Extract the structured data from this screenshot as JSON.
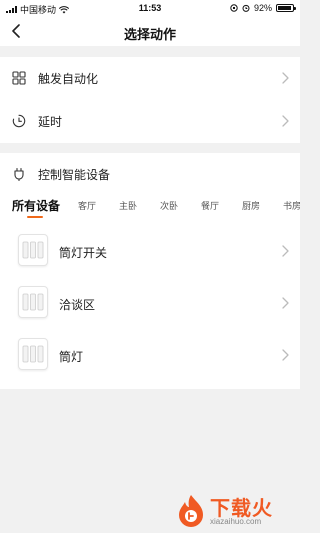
{
  "status_bar": {
    "carrier": "中国移动",
    "time": "11:53",
    "battery_percent": "92%",
    "battery_level": 0.92
  },
  "nav": {
    "title": "选择动作"
  },
  "trigger_section": {
    "items": [
      {
        "label": "触发自动化",
        "icon": "grid-icon"
      },
      {
        "label": "延时",
        "icon": "timer-icon"
      }
    ]
  },
  "device_section": {
    "title": "控制智能设备",
    "icon": "plug-icon",
    "tabs": [
      {
        "label": "所有设备",
        "active": true
      },
      {
        "label": "客厅",
        "active": false
      },
      {
        "label": "主卧",
        "active": false
      },
      {
        "label": "次卧",
        "active": false
      },
      {
        "label": "餐厅",
        "active": false
      },
      {
        "label": "厨房",
        "active": false
      },
      {
        "label": "书房",
        "active": false
      }
    ],
    "devices": [
      {
        "label": "筒灯开关",
        "icon": "wall-switch-icon"
      },
      {
        "label": "洽谈区",
        "icon": "wall-switch-icon"
      },
      {
        "label": "筒灯",
        "icon": "wall-switch-icon"
      }
    ]
  },
  "colors": {
    "accent": "#f0691a",
    "background": "#f1f1f1",
    "card": "#ffffff"
  },
  "watermark": {
    "title": "下载火",
    "url": "xiazaihuo.com"
  }
}
